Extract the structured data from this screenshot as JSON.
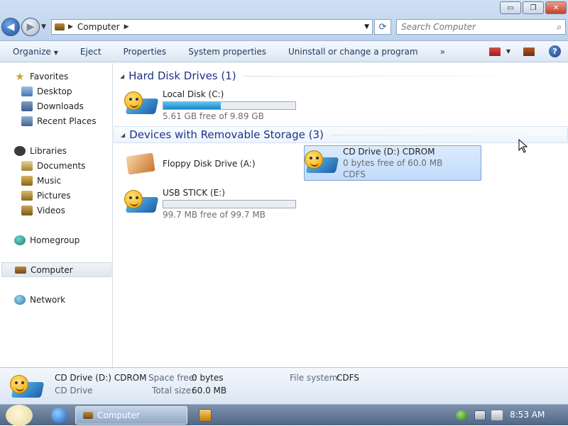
{
  "window": {
    "minimize_glyph": "▭",
    "maximize_glyph": "❐",
    "close_glyph": "✕"
  },
  "address": {
    "crumb": "Computer",
    "search_placeholder": "Search Computer"
  },
  "toolbar": {
    "organize": "Organize",
    "eject": "Eject",
    "properties": "Properties",
    "system_properties": "System properties",
    "uninstall": "Uninstall or change a program",
    "more": "»"
  },
  "nav": {
    "favorites": "Favorites",
    "desktop": "Desktop",
    "downloads": "Downloads",
    "recent_places": "Recent Places",
    "libraries": "Libraries",
    "documents": "Documents",
    "music": "Music",
    "pictures": "Pictures",
    "videos": "Videos",
    "homegroup": "Homegroup",
    "computer": "Computer",
    "network": "Network"
  },
  "groups": {
    "hard_disk": "Hard Disk Drives (1)",
    "removable": "Devices with Removable Storage (3)"
  },
  "drives": {
    "local_disk": {
      "name": "Local Disk (C:)",
      "free": "5.61 GB free of 9.89 GB",
      "used_fraction": 0.433
    },
    "floppy": {
      "name": "Floppy Disk Drive (A:)"
    },
    "cd": {
      "name": "CD Drive (D:) CDROM",
      "free": "0 bytes free of 60.0 MB",
      "fs": "CDFS"
    },
    "usb": {
      "name": "USB STICK (E:)",
      "free": "99.7 MB free of 99.7 MB",
      "used_fraction": 0.0
    }
  },
  "details": {
    "name": "CD Drive (D:) CDROM",
    "type": "CD Drive",
    "space_free_label": "Space free:",
    "space_free_value": "0 bytes",
    "total_size_label": "Total size:",
    "total_size_value": "60.0 MB",
    "fs_label": "File system:",
    "fs_value": "CDFS"
  },
  "taskbar": {
    "app_label": "Computer",
    "clock": "8:53 AM"
  }
}
